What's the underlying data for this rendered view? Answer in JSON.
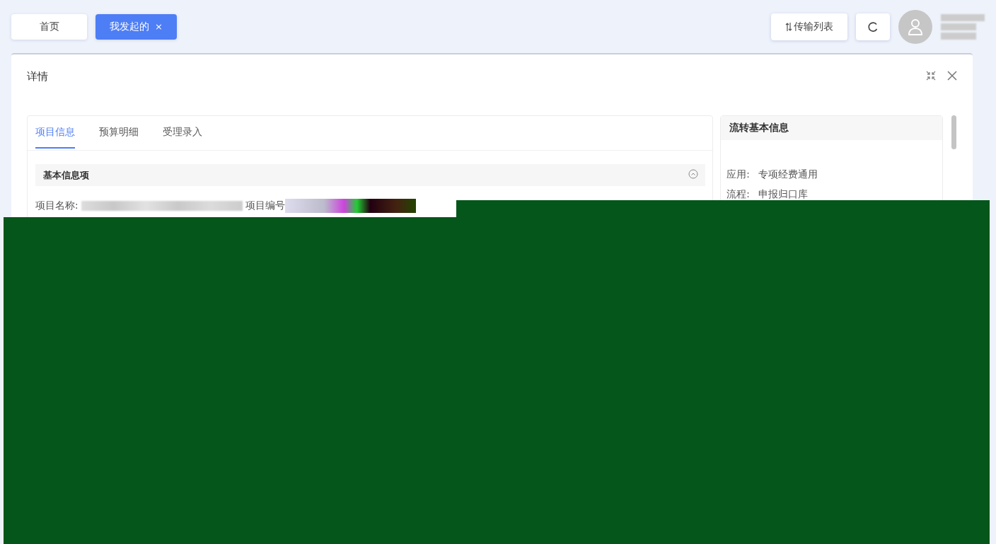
{
  "tabs": [
    {
      "label": "首页",
      "selected": false
    },
    {
      "label": "我发起的",
      "selected": true,
      "close_mark": "×"
    }
  ],
  "toolbar": {
    "transfer_button": "传输列表"
  },
  "dialog": {
    "title": "详情",
    "tabs": [
      {
        "label": "项目信息",
        "selected": true
      },
      {
        "label": "预算明细",
        "selected": false
      },
      {
        "label": "受理录入",
        "selected": false
      }
    ],
    "section": {
      "title": "基本信息项",
      "fields": [
        {
          "label": "项目名称:"
        },
        {
          "label": "项目编号"
        }
      ]
    },
    "side_panel": {
      "title": "流转基本信息",
      "fields": [
        {
          "label": "应用:",
          "value": "专项经费通用"
        },
        {
          "label": "流程:",
          "value": "申报归口库"
        }
      ]
    }
  }
}
